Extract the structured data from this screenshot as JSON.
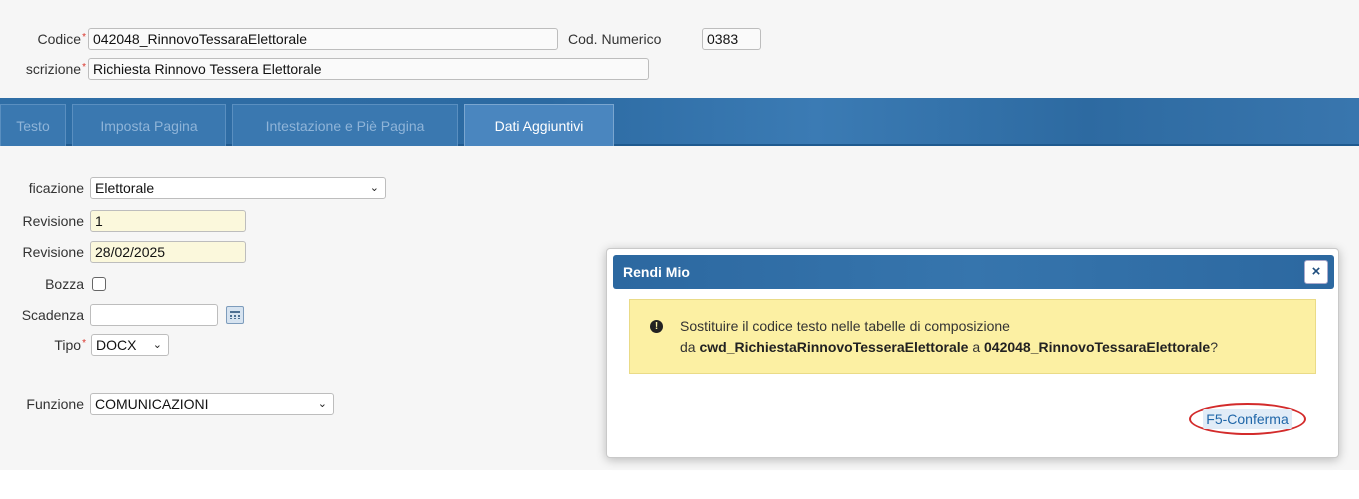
{
  "header": {
    "codice_label": "Codice",
    "codice_value": "042048_RinnovoTessaraElettorale",
    "cod_numerico_label": "Cod. Numerico",
    "cod_numerico_value": "0383",
    "descrizione_label": "scrizione",
    "descrizione_value": "Richiesta Rinnovo Tessera Elettorale",
    "required_mark": "*"
  },
  "tabs": [
    {
      "label": "Testo",
      "active": false
    },
    {
      "label": "Imposta Pagina",
      "active": false
    },
    {
      "label": "Intestazione e Piè Pagina",
      "active": false
    },
    {
      "label": "Dati Aggiuntivi",
      "active": true
    }
  ],
  "form": {
    "classificazione_label": "ficazione",
    "classificazione_value": "Elettorale",
    "num_revisione_label": "Revisione",
    "num_revisione_value": "1",
    "data_revisione_label": "Revisione",
    "data_revisione_value": "28/02/2025",
    "bozza_label": "Bozza",
    "scadenza_label": "Scadenza",
    "scadenza_value": "",
    "tipo_label": "Tipo",
    "tipo_value": "DOCX",
    "funzione_label": "Funzione",
    "funzione_value": "COMUNICAZIONI",
    "chevron": "⌄"
  },
  "modal": {
    "title": "Rendi Mio",
    "close_symbol": "×",
    "info_icon": "!",
    "message_line1": "Sostituire il codice testo nelle tabelle di composizione",
    "message_da": "da",
    "message_from": "cwd_RichiestaRinnovoTesseraElettorale",
    "message_a": "a",
    "message_to": "042048_RinnovoTessaraElettorale",
    "message_end": "?",
    "confirm_label": "F5-Conferma"
  },
  "colors": {
    "accent_blue": "#2f6ea6",
    "alert_yellow": "#fcf0a3",
    "highlight_red": "#d32b2b",
    "required_red": "#d9342b"
  }
}
